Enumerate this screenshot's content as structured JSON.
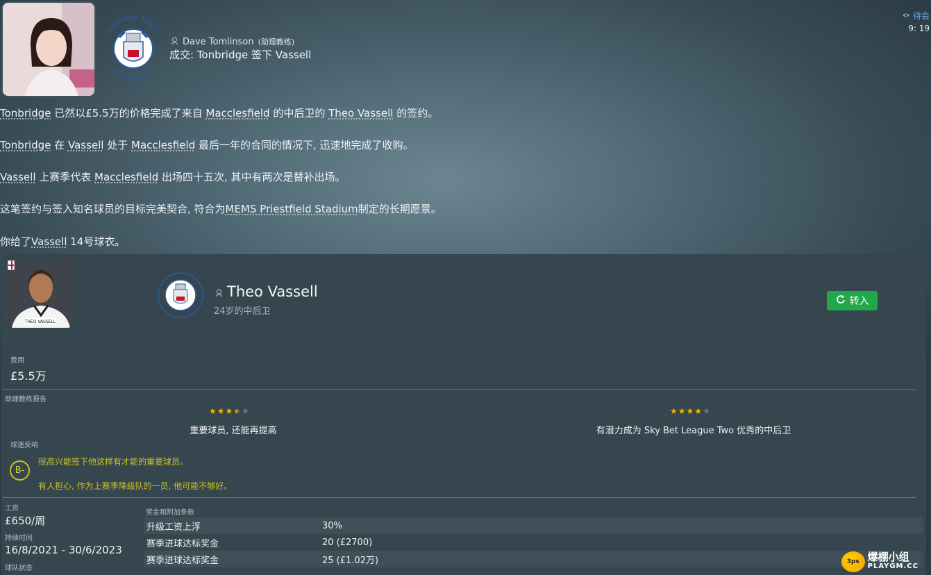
{
  "header": {
    "sender_name": "Dave Tomlinson",
    "sender_role": "(助理教练)",
    "headline": "成交: Tonbridge 签下 Vassell",
    "top_right_tag": "待会",
    "time": "9: 19"
  },
  "crest": {
    "arc_text_top": "Tonbridge Angels",
    "arc_text_bottom": "Football Club"
  },
  "body": {
    "p1": {
      "a": "Tonbridge",
      "b": " 已然以£5.5万的价格完成了来自 ",
      "c": "Macclesfield",
      "d": " 的中后卫的 ",
      "e": "Theo Vassell",
      "f": " 的签约。"
    },
    "p2": {
      "a": "Tonbridge",
      "b": " 在 ",
      "c": "Vassell",
      "d": " 处于 ",
      "e": "Macclesfield",
      "f": " 最后一年的合同的情况下, 迅速地完成了收购。"
    },
    "p3": {
      "a": "Vassell",
      "b": " 上赛季代表 ",
      "c": "Macclesfield",
      "d": " 出场四十五次, 其中有两次是替补出场。"
    },
    "p4": {
      "a": "这笔签约与签入知名球员的目标完美契合, 符合为",
      "b": "MEMS Priestfield Stadium",
      "c": "制定的长期愿景。"
    },
    "p5": {
      "a": "你给了",
      "b": "Vassell",
      "c": " 14号球衣。"
    }
  },
  "player": {
    "name": "Theo Vassell",
    "subtitle": "24岁的中后卫",
    "jersey_text": "THEO VASSELL",
    "transfer_button": "转入"
  },
  "fee": {
    "label": "费用",
    "value": "£5.5万"
  },
  "report": {
    "label": "助理教练报告",
    "current": {
      "rating": 3.5,
      "max": 5,
      "text": "重要球员, 还能再提高"
    },
    "potential": {
      "rating": 4,
      "max": 5,
      "text": "有潜力成为 Sky Bet League Two 优秀的中后卫"
    }
  },
  "fans": {
    "label": "球迷反响",
    "grade": "B-",
    "line1": "很高兴能签下他这样有才能的重要球员。",
    "line2": "有人担心, 作为上赛季降级队的一员, 他可能不够好。"
  },
  "contract": {
    "wage_label": "工资",
    "wage_value": "£650/周",
    "duration_label": "持续时间",
    "duration_value": "16/8/2021 - 30/6/2023",
    "status_label": "球队状态"
  },
  "bonuses": {
    "label": "奖金和附加条款",
    "rows": [
      {
        "k": "升级工资上浮",
        "v": "30%"
      },
      {
        "k": "赛季进球达标奖金",
        "v": "20 (£2700)"
      },
      {
        "k": "赛季进球达标奖金",
        "v": "25 (£1.02万)"
      }
    ]
  },
  "watermark": {
    "logo": "3ps",
    "line1": "爆棚小组",
    "line2": "PLAYGM.CC"
  },
  "colors": {
    "accent_green": "#20a84a",
    "fan_yellow": "#c9c320",
    "star_gold": "#f2b600"
  },
  "icons": {
    "sender": "person-icon",
    "refresh": "refresh-icon",
    "eye": "eye-icon"
  }
}
